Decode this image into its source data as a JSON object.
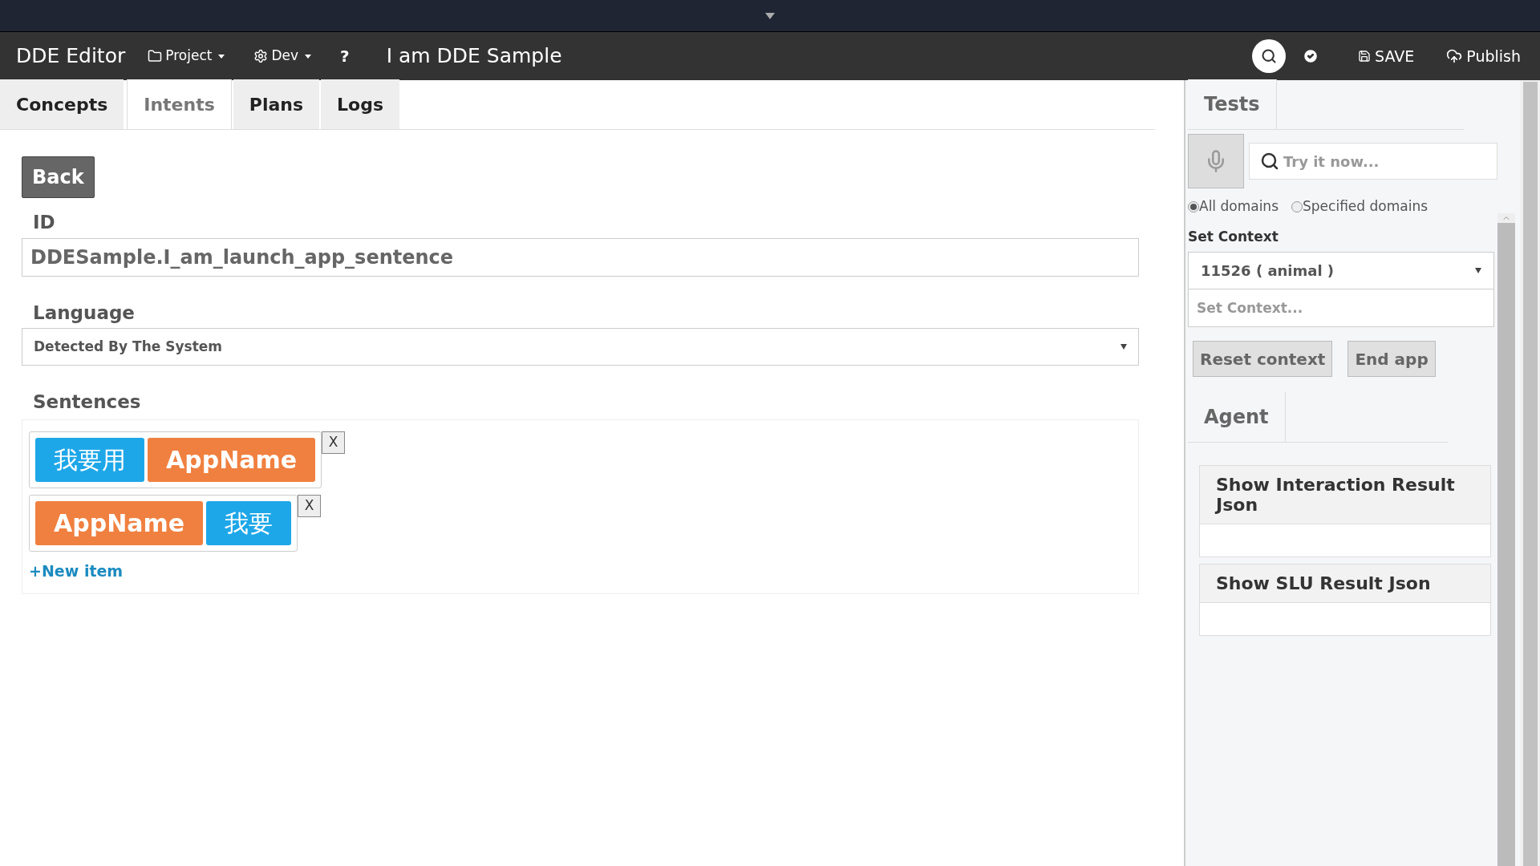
{
  "navbar": {
    "brand": "DDE Editor",
    "menus": [
      {
        "label": "Project",
        "kind": "folder"
      },
      {
        "label": "Dev",
        "kind": "gear"
      },
      {
        "label": "?",
        "kind": "plain"
      }
    ],
    "project_title": "I am DDE Sample",
    "actions": [
      {
        "label": "SAVE",
        "kind": "save"
      },
      {
        "label": "Publish",
        "kind": "publish"
      }
    ]
  },
  "tabs": [
    {
      "label": "Concepts",
      "selected": false
    },
    {
      "label": "Intents",
      "selected": true
    },
    {
      "label": "Plans",
      "selected": false
    },
    {
      "label": "Logs",
      "selected": false
    }
  ],
  "editor": {
    "back": "Back",
    "id_label": "ID",
    "id_value": "DDESample.I_am_launch_app_sentence",
    "language_label": "Language",
    "language_value": "Detected By The System",
    "sentences_label": "Sentences",
    "sentences": [
      {
        "tokens": [
          {
            "text": "我要用",
            "kind": "text"
          },
          {
            "text": "AppName",
            "kind": "slot"
          }
        ],
        "remove": "X"
      },
      {
        "tokens": [
          {
            "text": "AppName",
            "kind": "slot"
          },
          {
            "text": "我要",
            "kind": "text"
          }
        ],
        "remove": "X"
      }
    ],
    "new_item": "+New item"
  },
  "tests": {
    "tab": "Tests",
    "search_placeholder": "Try it now...",
    "domains": [
      {
        "label": "All domains",
        "selected": true
      },
      {
        "label": "Specified domains",
        "selected": false
      }
    ],
    "context_label": "Set Context",
    "context_value": "11526 ( animal )",
    "context_placeholder": "Set Context...",
    "buttons": [
      "Reset context",
      "End app"
    ],
    "agent_tab": "Agent",
    "panels": [
      {
        "title": "Show Interaction Result Json"
      },
      {
        "title": "Show SLU Result Json"
      }
    ]
  }
}
